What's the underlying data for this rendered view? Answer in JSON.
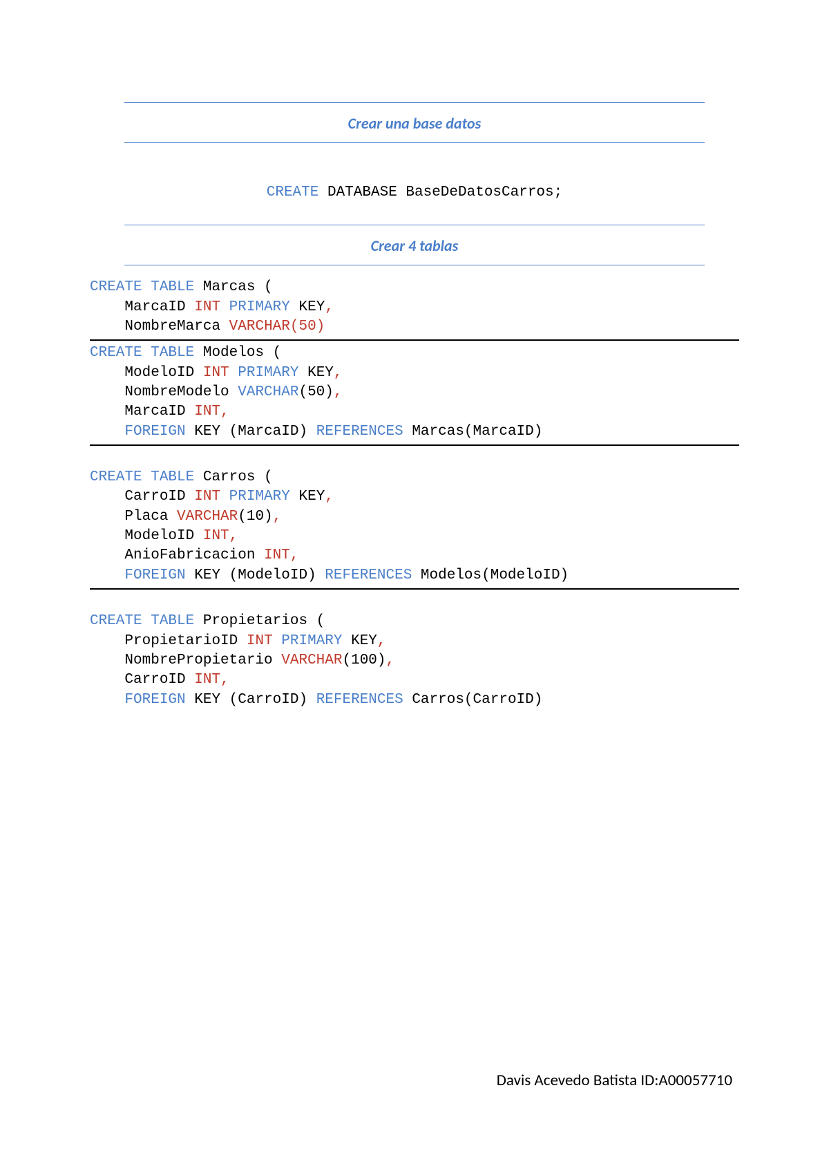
{
  "headings": {
    "create_db": "Crear una base datos",
    "create_tables": "Crear 4 tablas"
  },
  "sql": {
    "create_db": {
      "create_kw": "CREATE",
      "rest": " DATABASE BaseDeDatosCarros;"
    },
    "marcas": {
      "line1_kw": "CREATE TABLE",
      "line1_rest": " Marcas (",
      "indent": "    ",
      "l2_a": "MarcaID ",
      "l2_int": "INT",
      "l2_sp": " ",
      "l2_primary": "PRIMARY",
      "l2_key": " KEY",
      "l2_comma": ",",
      "l3_a": "NombreMarca ",
      "l3_varchar": "VARCHAR",
      "l3_paren": "(50)"
    },
    "modelos": {
      "line1_kw": "CREATE TABLE",
      "line1_rest": " Modelos (",
      "indent": "    ",
      "l2_a": "ModeloID ",
      "l2_int": "INT",
      "l2_sp": " ",
      "l2_primary": "PRIMARY",
      "l2_key": " KEY",
      "l2_comma": ",",
      "l3_a": "NombreModelo ",
      "l3_varchar": "VARCHAR",
      "l3_paren": "(50)",
      "l3_comma": ",",
      "l4_a": "MarcaID ",
      "l4_int": "INT",
      "l4_comma": ",",
      "l5_fk": "FOREIGN",
      "l5_key": " KEY ",
      "l5_col": "(MarcaID) ",
      "l5_ref": "REFERENCES",
      "l5_tgt": " Marcas(MarcaID)"
    },
    "carros": {
      "line1_kw": "CREATE TABLE",
      "line1_rest": " Carros (",
      "indent": "    ",
      "l2_a": "CarroID ",
      "l2_int": "INT",
      "l2_sp": " ",
      "l2_primary": "PRIMARY",
      "l2_key": " KEY",
      "l2_comma": ",",
      "l3_a": "Placa ",
      "l3_varchar": "VARCHAR",
      "l3_paren": "(10)",
      "l3_comma": ",",
      "l4_a": "ModeloID ",
      "l4_int": "INT",
      "l4_comma": ",",
      "l5_a": "AnioFabricacion ",
      "l5_int": "INT",
      "l5_comma": ",",
      "l6_fk": "FOREIGN",
      "l6_key": " KEY ",
      "l6_col": "(ModeloID) ",
      "l6_ref": "REFERENCES",
      "l6_tgt": " Modelos(ModeloID)"
    },
    "propietarios": {
      "line1_kw": "CREATE TABLE",
      "line1_rest": " Propietarios (",
      "indent": "    ",
      "l2_a": "PropietarioID ",
      "l2_int": "INT",
      "l2_sp": " ",
      "l2_primary": "PRIMARY",
      "l2_key": " KEY",
      "l2_comma": ",",
      "l3_a": "NombrePropietario ",
      "l3_varchar": "VARCHAR",
      "l3_paren": "(100)",
      "l3_comma": ",",
      "l4_a": "CarroID ",
      "l4_int": "INT",
      "l4_comma": ",",
      "l5_fk": "FOREIGN",
      "l5_key": " KEY ",
      "l5_col": "(CarroID) ",
      "l5_ref": "REFERENCES",
      "l5_tgt": " Carros(CarroID)"
    }
  },
  "footer": "Davis Acevedo Batista ID:A00057710"
}
